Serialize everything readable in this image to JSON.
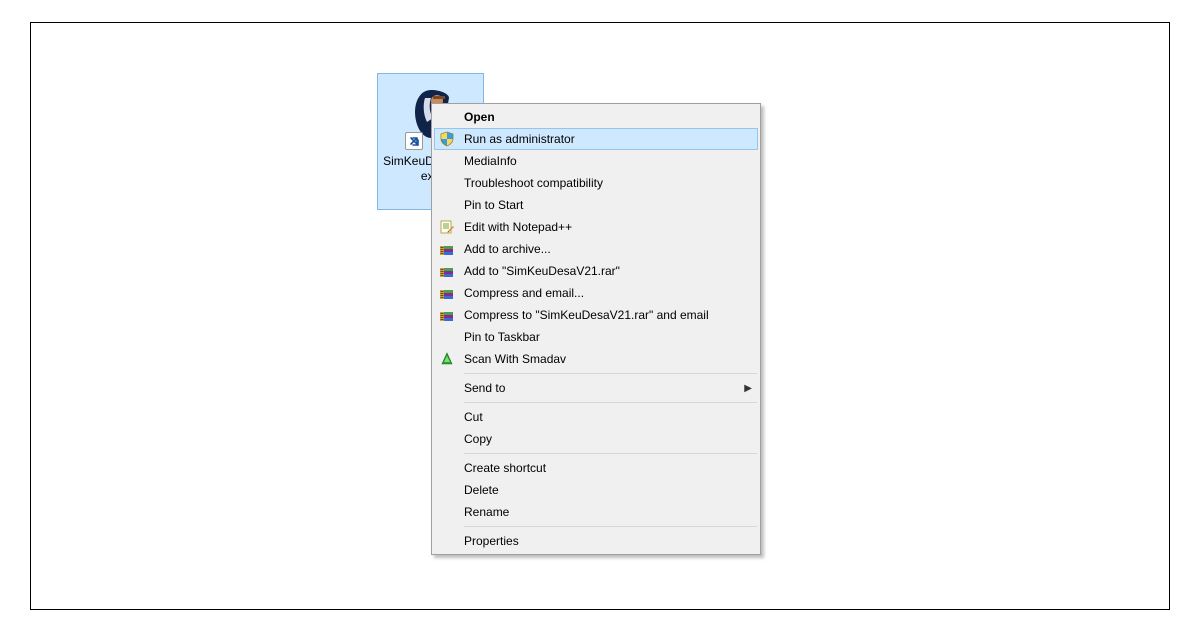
{
  "desktop": {
    "selected_icon_label": "SimKeuDesaV21.exe"
  },
  "context_menu": {
    "open": "Open",
    "run_admin": "Run as administrator",
    "mediainfo": "MediaInfo",
    "troubleshoot": "Troubleshoot compatibility",
    "pin_start": "Pin to Start",
    "edit_notepadpp": "Edit with Notepad++",
    "add_to_archive": "Add to archive...",
    "add_to_named_rar": "Add to \"SimKeuDesaV21.rar\"",
    "compress_email": "Compress and email...",
    "compress_named_email": "Compress to \"SimKeuDesaV21.rar\" and email",
    "pin_taskbar": "Pin to Taskbar",
    "scan_smadav": "Scan With Smadav",
    "send_to": "Send to",
    "cut": "Cut",
    "copy": "Copy",
    "create_shortcut": "Create shortcut",
    "delete": "Delete",
    "rename": "Rename",
    "properties": "Properties"
  }
}
